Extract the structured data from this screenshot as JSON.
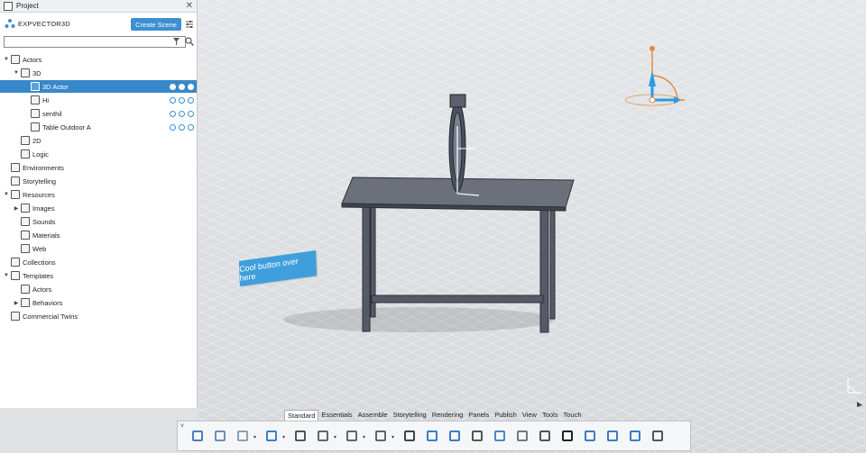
{
  "panel": {
    "title": "Project",
    "close_glyph": "✕",
    "project_name": "EXPVECTOR3D",
    "create_scene_label": "Create Scene",
    "search": {
      "value": "",
      "placeholder": ""
    },
    "tree": [
      {
        "label": "Actors",
        "level": 0,
        "expanded": true,
        "icon": "actors-icon"
      },
      {
        "label": "3D",
        "level": 1,
        "expanded": true,
        "icon": "cube-icon"
      },
      {
        "label": "3D Actor",
        "level": 2,
        "selected": true,
        "icon": "actor-3d-icon",
        "row_icons": true
      },
      {
        "label": "Hi",
        "level": 2,
        "icon": "model-icon",
        "row_icons": true
      },
      {
        "label": "senthil",
        "level": 2,
        "icon": "model-icon",
        "row_icons": true
      },
      {
        "label": "Table Outdoor A",
        "level": 2,
        "icon": "model-icon",
        "row_icons": true
      },
      {
        "label": "2D",
        "level": 1,
        "icon": "2d-icon"
      },
      {
        "label": "Logic",
        "level": 1,
        "icon": "logic-icon"
      },
      {
        "label": "Environments",
        "level": 0,
        "icon": "environment-icon"
      },
      {
        "label": "Storytelling",
        "level": 0,
        "icon": "storytelling-icon"
      },
      {
        "label": "Resources",
        "level": 0,
        "expanded": true,
        "icon": "resources-icon"
      },
      {
        "label": "Images",
        "level": 1,
        "collapsed": true,
        "icon": "images-icon"
      },
      {
        "label": "Sounds",
        "level": 1,
        "icon": "sounds-icon"
      },
      {
        "label": "Materials",
        "level": 1,
        "icon": "materials-icon"
      },
      {
        "label": "Web",
        "level": 1,
        "icon": "web-icon"
      },
      {
        "label": "Collections",
        "level": 0,
        "icon": "collections-icon"
      },
      {
        "label": "Templates",
        "level": 0,
        "expanded": true,
        "icon": "templates-icon"
      },
      {
        "label": "Actors",
        "level": 1,
        "icon": "actors-icon"
      },
      {
        "label": "Behaviors",
        "level": 1,
        "collapsed": true,
        "icon": "behaviors-icon"
      },
      {
        "label": "Commercial Twins",
        "level": 0,
        "icon": "twins-icon"
      }
    ]
  },
  "viewport": {
    "callout_text": "Cool button over here"
  },
  "toolbar": {
    "tabs": [
      "Standard",
      "Essentials",
      "Assemble",
      "Storytelling",
      "Rendering",
      "Panels",
      "Publish",
      "View",
      "Tools",
      "Touch"
    ],
    "active_tab": "Standard",
    "tools": [
      {
        "name": "cut-icon",
        "color": "#4a7fb8"
      },
      {
        "name": "copy-icon",
        "color": "#6e8fb0"
      },
      {
        "name": "paste-icon",
        "color": "#8aa0b8",
        "dropdown": true
      },
      {
        "name": "undo-icon",
        "color": "#3d7fc7",
        "dropdown": true
      },
      {
        "name": "zoom-fit-icon",
        "color": "#555555"
      },
      {
        "name": "tree-icon",
        "color": "#666666",
        "dropdown": true
      },
      {
        "name": "select-icon",
        "color": "#666666",
        "dropdown": true
      },
      {
        "name": "brush-icon",
        "color": "#666666",
        "dropdown": true
      },
      {
        "name": "search-icon",
        "color": "#444444"
      },
      {
        "name": "book-icon",
        "color": "#3b7dc4"
      },
      {
        "name": "list-icon",
        "color": "#3b7dc4"
      },
      {
        "name": "document-icon",
        "color": "#555555"
      },
      {
        "name": "users-icon",
        "color": "#4a86c8"
      },
      {
        "name": "note-icon",
        "color": "#777777"
      },
      {
        "name": "help-icon",
        "color": "#555555"
      },
      {
        "name": "vr-headset-icon",
        "color": "#222222"
      },
      {
        "name": "device-icon",
        "color": "#3b7dc4"
      },
      {
        "name": "share-icon",
        "color": "#3b7dc4"
      },
      {
        "name": "network-icon",
        "color": "#3b7dc4"
      },
      {
        "name": "panel-icon",
        "color": "#555555"
      }
    ]
  },
  "colors": {
    "accent": "#3d8fd1",
    "selection": "#3788c9",
    "callout": "#3f9fdc",
    "axis_orange": "#e08a3a",
    "axis_blue": "#2d9be0"
  }
}
